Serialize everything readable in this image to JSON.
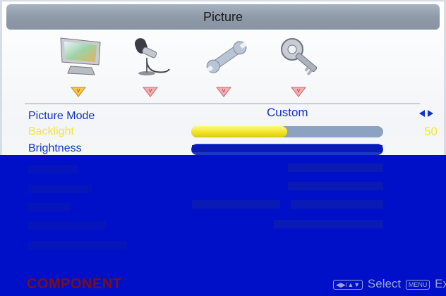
{
  "menu": {
    "title": "Picture",
    "icons": [
      "display-icon",
      "microphone-icon",
      "wrench-icon",
      "key-icon"
    ],
    "rows": [
      {
        "label": "Picture Mode",
        "value": "Custom"
      },
      {
        "label": "Backlight",
        "value": "50",
        "level": 0.5
      },
      {
        "label": "Brightness"
      }
    ]
  },
  "footer": {
    "source": "COMPONENT",
    "select_label": "Select",
    "exit_label": "Exit",
    "menu_key": "MENU"
  },
  "colors": {
    "background": "#0010c8",
    "label": "#1033c8",
    "highlight": "#f2e63a",
    "source": "#7a0d18"
  }
}
